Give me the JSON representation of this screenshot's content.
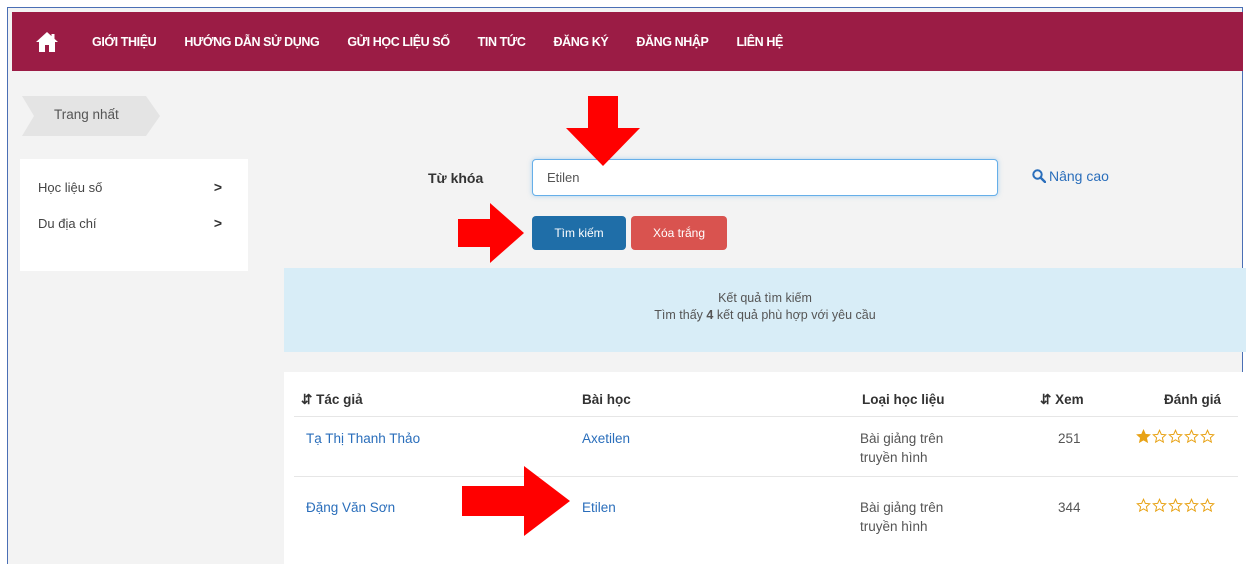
{
  "nav": {
    "home_icon": "home-icon",
    "items": [
      "GIỚI THIỆU",
      "HƯỚNG DẪN SỬ DỤNG",
      "GỬI HỌC LIỆU SỐ",
      "TIN TỨC",
      "ĐĂNG KÝ",
      "ĐĂNG NHẬP",
      "LIÊN HỆ"
    ]
  },
  "breadcrumb": {
    "label": "Trang nhất"
  },
  "sidebar": {
    "items": [
      {
        "label": "Học liệu số"
      },
      {
        "label": "Du địa chí"
      }
    ]
  },
  "search": {
    "keyword_label": "Từ khóa",
    "keyword_value": "Etilen",
    "advanced_label": "Nâng cao",
    "search_button": "Tìm kiếm",
    "clear_button": "Xóa trắng"
  },
  "results": {
    "title": "Kết quả tìm kiếm",
    "summary_prefix": "Tìm thấy",
    "count": "4",
    "summary_suffix": "kết quả phù hợp với yêu cầu"
  },
  "table": {
    "headers": {
      "author": "Tác giả",
      "lesson": "Bài học",
      "type": "Loại học liệu",
      "views": "Xem",
      "rating": "Đánh giá"
    },
    "rows": [
      {
        "author": "Tạ Thị Thanh Thảo",
        "lesson": "Axetilen",
        "type_line1": "Bài giảng trên",
        "type_line2": "truyền hình",
        "views": "251",
        "rating": 1
      },
      {
        "author": "Đặng Văn Sơn",
        "lesson": "Etilen",
        "type_line1": "Bài giảng trên",
        "type_line2": "truyền hình",
        "views": "344",
        "rating": 0
      }
    ]
  },
  "colors": {
    "navbar": "#9b1c45",
    "search_button": "#1f6ea8",
    "clear_button": "#d9534f",
    "result_banner": "#d8edf7",
    "link": "#2a6ebb",
    "arrow": "#ff0000",
    "star": "#e8a317"
  }
}
